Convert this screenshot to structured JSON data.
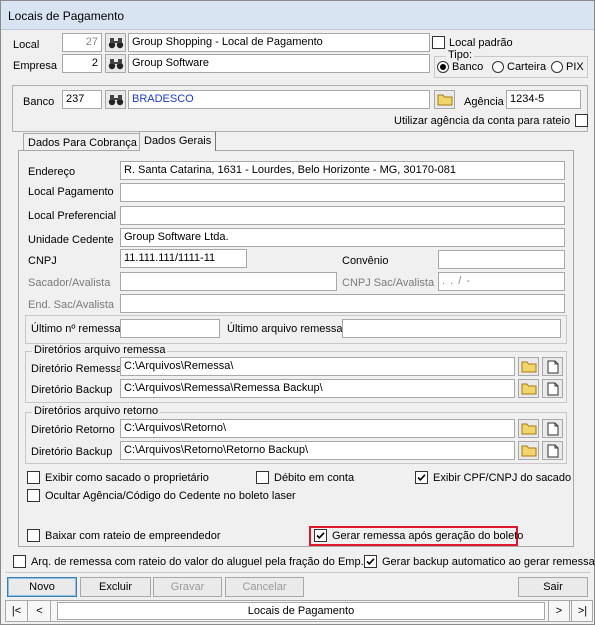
{
  "window": {
    "title": "Locais de Pagamento"
  },
  "header": {
    "local_label": "Local",
    "local_code": "27",
    "local_name": "Group Shopping - Local de Pagamento",
    "local_padrao_label": "Local padrão",
    "local_padrao_checked": false,
    "empresa_label": "Empresa",
    "empresa_code": "2",
    "empresa_name": "Group Software",
    "tipo_label": "Tipo:",
    "tipo_options": [
      "Banco",
      "Carteira",
      "PIX"
    ],
    "tipo_selected": "Banco"
  },
  "banco": {
    "label": "Banco",
    "code": "237",
    "name": "BRADESCO",
    "agencia_label": "Agência",
    "agencia_value": "1234-5",
    "utilizar_label": "Utilizar agência da conta para rateio",
    "utilizar_checked": false
  },
  "tabs": [
    {
      "label": "Dados Para Cobrança",
      "active": false
    },
    {
      "label": "Dados Gerais",
      "active": true
    }
  ],
  "dados_gerais": {
    "endereco_label": "Endereço",
    "endereco_value": "R. Santa Catarina, 1631 - Lourdes, Belo Horizonte - MG, 30170-081",
    "local_pagamento_label": "Local Pagamento",
    "local_pagamento_value": "",
    "local_preferencial_label": "Local Preferencial",
    "local_preferencial_value": "",
    "unidade_cedente_label": "Unidade Cedente",
    "unidade_cedente_value": "Group Software Ltda.",
    "cnpj_label": "CNPJ",
    "cnpj_value": "11.111.111/1111-11",
    "convenio_label": "Convênio",
    "convenio_value": "",
    "sacador_label": "Sacador/Avalista",
    "sacador_value": "",
    "cnpj_sac_label": "CNPJ Sac/Avalista",
    "cnpj_sac_value": ".   .   /   -",
    "end_sac_label": "End. Sac/Avalista",
    "end_sac_value": "",
    "ultimo_remessa_label": "Último nº remessa",
    "ultimo_remessa_value": "",
    "ultimo_arquivo_label": "Último arquivo remessa",
    "ultimo_arquivo_value": ""
  },
  "remessa_group": {
    "title": "Diretórios arquivo remessa",
    "dir_remessa_label": "Diretório Remessa",
    "dir_remessa_value": "C:\\Arquivos\\Remessa\\",
    "dir_backup_label": "Diretório Backup",
    "dir_backup_value": "C:\\Arquivos\\Remessa\\Remessa Backup\\"
  },
  "retorno_group": {
    "title": "Diretórios arquivo retorno",
    "dir_retorno_label": "Diretório Retorno",
    "dir_retorno_value": "C:\\Arquivos\\Retorno\\",
    "dir_backup_label": "Diretório Backup",
    "dir_backup_value": "C:\\Arquivos\\Retorno\\Retorno Backup\\"
  },
  "options": {
    "exibir_sacado": {
      "label": "Exibir como sacado o proprietário",
      "checked": false
    },
    "debito_conta": {
      "label": "Débito em conta",
      "checked": false
    },
    "exibir_cpf": {
      "label": "Exibir CPF/CNPJ do sacado",
      "checked": true
    },
    "ocultar_agencia": {
      "label": "Ocultar Agência/Código do Cedente no boleto laser",
      "checked": false
    },
    "baixar_rateio": {
      "label": "Baixar com rateio de empreendedor",
      "checked": false
    },
    "gerar_remessa": {
      "label": "Gerar remessa após geração do boleto",
      "checked": true
    }
  },
  "footer_options": {
    "arq_remessa": {
      "label": "Arq. de remessa com rateio do valor do aluguel pela fração do Emp.",
      "checked": false
    },
    "gerar_backup": {
      "label": "Gerar backup automatico ao gerar remessa",
      "checked": true
    }
  },
  "buttons": {
    "novo": "Novo",
    "excluir": "Excluir",
    "gravar": "Gravar",
    "cancelar": "Cancelar",
    "sair": "Sair"
  },
  "statusbar": {
    "text": "Locais de Pagamento",
    "first": "|<",
    "prev": "<",
    "next": ">",
    "last": ">|"
  },
  "colors": {
    "highlight": "#e0182c",
    "banco_text": "#1a3bd1",
    "titlebar": "#d8e4f2"
  }
}
